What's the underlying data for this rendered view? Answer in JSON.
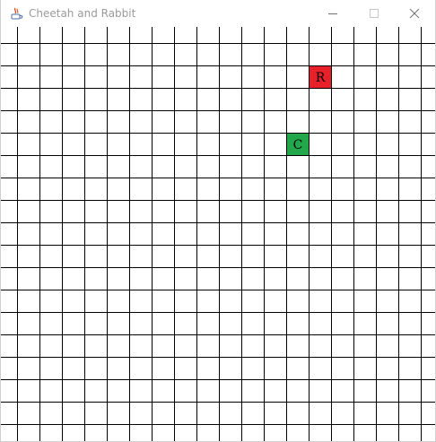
{
  "window": {
    "title": "Cheetah and Rabbit",
    "icon": "java-cup-icon"
  },
  "controls": {
    "minimize_icon": "minimize-icon",
    "maximize_icon": "maximize-icon",
    "close_icon": "close-icon"
  },
  "board": {
    "columns": 19,
    "rows": 19,
    "grid_color": "#000000",
    "background": "#ffffff",
    "pieces": [
      {
        "label": "R",
        "col": 13,
        "row": 1,
        "color": "#e8202a"
      },
      {
        "label": "C",
        "col": 12,
        "row": 4,
        "color": "#22a84a"
      }
    ]
  }
}
